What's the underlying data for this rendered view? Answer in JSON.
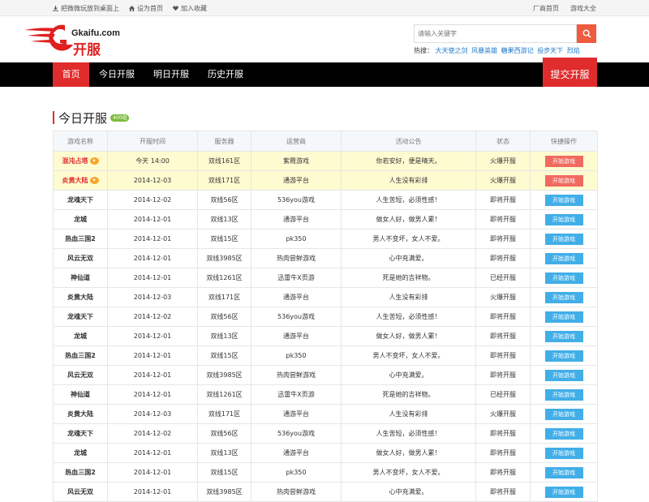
{
  "topbar": {
    "left_links": [
      {
        "label": "把微微玩放到桌面上",
        "icon": "download-icon"
      },
      {
        "label": "设为首页",
        "icon": "home-icon"
      },
      {
        "label": "加入收藏",
        "icon": "heart-icon"
      }
    ],
    "right_links": [
      "厂商首页",
      "游戏大全"
    ]
  },
  "header": {
    "logo_domain": "Gkaifu.com",
    "logo_name": "开服",
    "search_placeholder": "请输入关键字",
    "hot_label": "热搜：",
    "hot_links": [
      "大天使之剑",
      "风暴英雄",
      "糖果西游记",
      "投步天下",
      "烈焰"
    ]
  },
  "nav": {
    "items": [
      "首页",
      "今日开服",
      "明日开服",
      "历史开服"
    ],
    "active": 0,
    "submit": "提交开服"
  },
  "section": {
    "title": "今日开服",
    "badge": "400组"
  },
  "table": {
    "headers": [
      "游戏名称",
      "开服时间",
      "服务器",
      "运营商",
      "活动公告",
      "状态",
      "快捷操作"
    ],
    "rows": [
      {
        "name": "混沌占塔",
        "time": "今天 14:00",
        "server": "双线161区",
        "operator": "紫霞游戏",
        "notice": "你若安好，便是晴天。",
        "status": "火爆开服",
        "status_type": "hot",
        "action": "开始游戏",
        "top": true
      },
      {
        "name": "炎黄大陆",
        "time": "2014-12-03",
        "server": "双线171区",
        "operator": "通游平台",
        "notice": "人生没有彩排",
        "status": "火爆开服",
        "status_type": "hot",
        "action": "开始游戏",
        "top": true
      },
      {
        "name": "龙魂天下",
        "time": "2014-12-02",
        "server": "双线56区",
        "operator": "536you游戏",
        "notice": "人生苦短，必须性感！",
        "status": "即将开服",
        "status_type": "soon",
        "action": "开始游戏",
        "top": false
      },
      {
        "name": "龙城",
        "time": "2014-12-01",
        "server": "双线13区",
        "operator": "通游平台",
        "notice": "做女人好，做男人累！",
        "status": "即将开服",
        "status_type": "soon",
        "action": "开始游戏",
        "top": false
      },
      {
        "name": "热血三国2",
        "time": "2014-12-01",
        "server": "双线15区",
        "operator": "pk350",
        "notice": "男人不变坏，女人不爱。",
        "status": "即将开服",
        "status_type": "soon",
        "action": "开始游戏",
        "top": false
      },
      {
        "name": "风云无双",
        "time": "2014-12-01",
        "server": "双线3985区",
        "operator": "热肉尝鲜游戏",
        "notice": "心中充满爱。",
        "status": "即将开服",
        "status_type": "soon",
        "action": "开始游戏",
        "top": false
      },
      {
        "name": "神仙道",
        "time": "2014-12-01",
        "server": "双线1261区",
        "operator": "迅雷牛X页游",
        "notice": "死是她的吉祥物。",
        "status": "已经开服",
        "status_type": "done",
        "action": "开始游戏",
        "top": false
      },
      {
        "name": "炎黄大陆",
        "time": "2014-12-03",
        "server": "双线171区",
        "operator": "通游平台",
        "notice": "人生没有彩排",
        "status": "火爆开服",
        "status_type": "hot",
        "action": "开始游戏",
        "top": false
      },
      {
        "name": "龙魂天下",
        "time": "2014-12-02",
        "server": "双线56区",
        "operator": "536you游戏",
        "notice": "人生苦短，必须性感！",
        "status": "即将开服",
        "status_type": "soon",
        "action": "开始游戏",
        "top": false
      },
      {
        "name": "龙城",
        "time": "2014-12-01",
        "server": "双线13区",
        "operator": "通游平台",
        "notice": "做女人好，做男人累！",
        "status": "即将开服",
        "status_type": "soon",
        "action": "开始游戏",
        "top": false
      },
      {
        "name": "热血三国2",
        "time": "2014-12-01",
        "server": "双线15区",
        "operator": "pk350",
        "notice": "男人不变坏，女人不爱。",
        "status": "即将开服",
        "status_type": "soon",
        "action": "开始游戏",
        "top": false
      },
      {
        "name": "风云无双",
        "time": "2014-12-01",
        "server": "双线3985区",
        "operator": "热肉尝鲜游戏",
        "notice": "心中充满爱。",
        "status": "即将开服",
        "status_type": "soon",
        "action": "开始游戏",
        "top": false
      },
      {
        "name": "神仙道",
        "time": "2014-12-01",
        "server": "双线1261区",
        "operator": "迅雷牛X页游",
        "notice": "死是她的吉祥物。",
        "status": "已经开服",
        "status_type": "done",
        "action": "开始游戏",
        "top": false
      },
      {
        "name": "炎黄大陆",
        "time": "2014-12-03",
        "server": "双线171区",
        "operator": "通游平台",
        "notice": "人生没有彩排",
        "status": "火爆开服",
        "status_type": "hot",
        "action": "开始游戏",
        "top": false
      },
      {
        "name": "龙魂天下",
        "time": "2014-12-02",
        "server": "双线56区",
        "operator": "536you游戏",
        "notice": "人生苦短，必须性感！",
        "status": "即将开服",
        "status_type": "soon",
        "action": "开始游戏",
        "top": false
      },
      {
        "name": "龙城",
        "time": "2014-12-01",
        "server": "双线13区",
        "operator": "通游平台",
        "notice": "做女人好，做男人累！",
        "status": "即将开服",
        "status_type": "soon",
        "action": "开始游戏",
        "top": false
      },
      {
        "name": "热血三国2",
        "time": "2014-12-01",
        "server": "双线15区",
        "operator": "pk350",
        "notice": "男人不变坏，女人不爱。",
        "status": "即将开服",
        "status_type": "soon",
        "action": "开始游戏",
        "top": false
      },
      {
        "name": "风云无双",
        "time": "2014-12-01",
        "server": "双线3985区",
        "operator": "热肉尝鲜游戏",
        "notice": "心中充满爱。",
        "status": "即将开服",
        "status_type": "soon",
        "action": "开始游戏",
        "top": false
      }
    ]
  },
  "colors": {
    "accent_red": "#e02c2c",
    "nav_bg": "#000000",
    "search_btn": "#ee5b3e",
    "play_red": "#f06a60",
    "play_blue": "#42aee8",
    "status_soon": "#2a8f2a",
    "top_row_bg": "#fffbd1"
  }
}
